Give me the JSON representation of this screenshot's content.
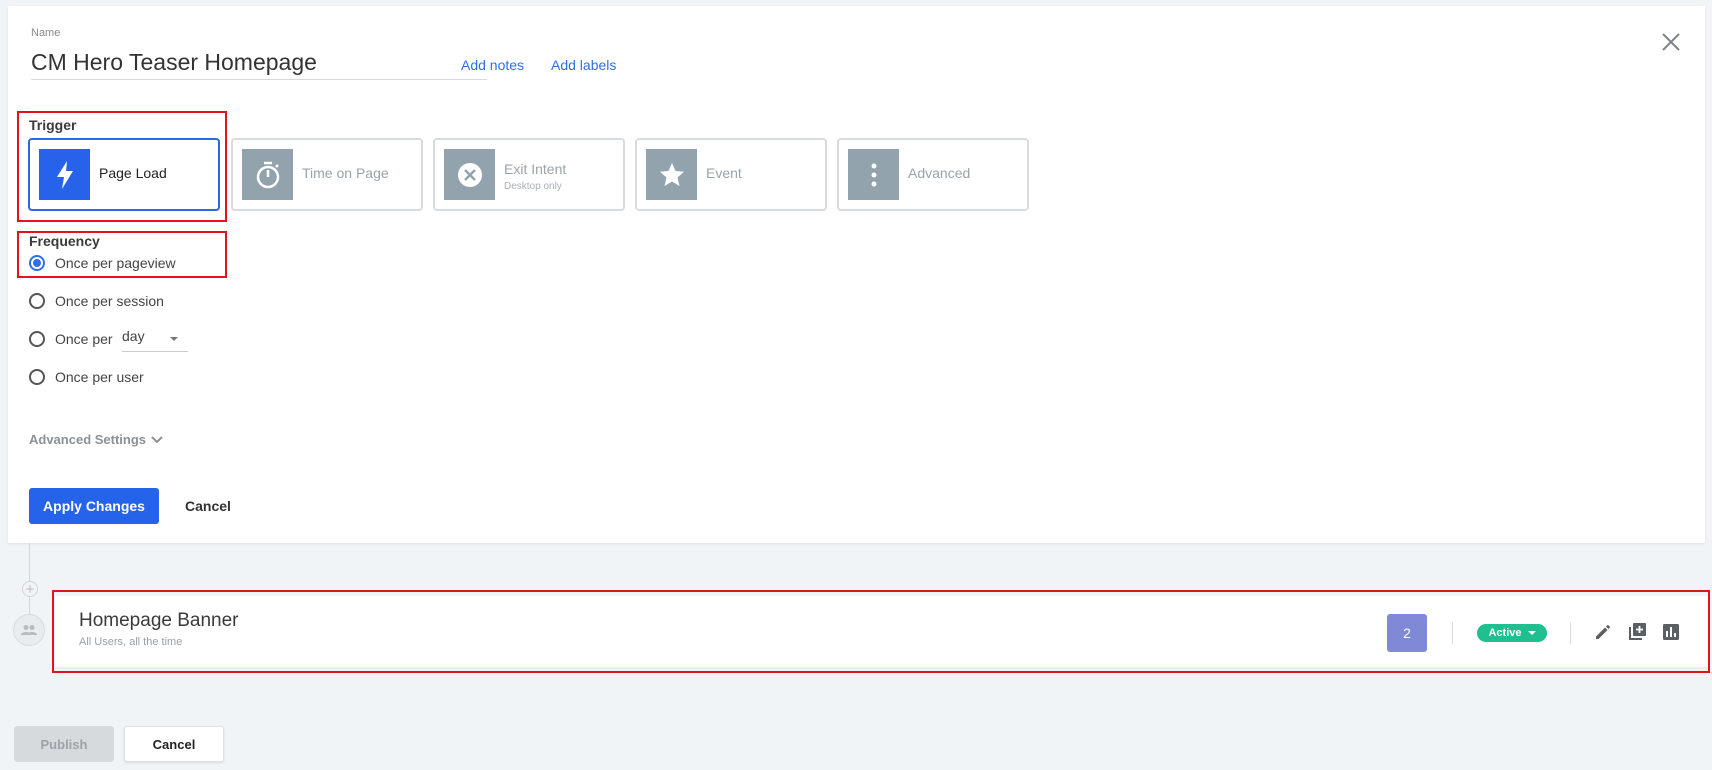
{
  "form": {
    "name_label": "Name",
    "name_value": "CM Hero Teaser Homepage",
    "add_notes": "Add notes",
    "add_labels": "Add labels"
  },
  "trigger": {
    "title": "Trigger",
    "options": [
      {
        "label": "Page Load",
        "sub": "",
        "icon": "lightning-icon",
        "selected": true
      },
      {
        "label": "Time on Page",
        "sub": "",
        "icon": "stopwatch-icon",
        "selected": false
      },
      {
        "label": "Exit Intent",
        "sub": "Desktop only",
        "icon": "close-circle-icon",
        "selected": false
      },
      {
        "label": "Event",
        "sub": "",
        "icon": "star-icon",
        "selected": false
      },
      {
        "label": "Advanced",
        "sub": "",
        "icon": "more-vertical-icon",
        "selected": false
      }
    ]
  },
  "frequency": {
    "title": "Frequency",
    "options": [
      {
        "label": "Once per pageview",
        "checked": true
      },
      {
        "label": "Once per session",
        "checked": false
      },
      {
        "label": "Once per",
        "checked": false
      },
      {
        "label": "Once per user",
        "checked": false
      }
    ],
    "day_select": "day"
  },
  "advanced_settings": "Advanced Settings",
  "actions": {
    "apply": "Apply Changes",
    "cancel": "Cancel"
  },
  "campaign": {
    "title": "Homepage Banner",
    "subtitle": "All Users, all the time",
    "variant_count": "2",
    "status": "Active"
  },
  "footer": {
    "publish": "Publish",
    "cancel": "Cancel"
  },
  "colors": {
    "accent": "#2563eb",
    "active_badge": "#1fbf8f",
    "variant_badge": "#7f89d6",
    "highlight": "#e0141a"
  }
}
